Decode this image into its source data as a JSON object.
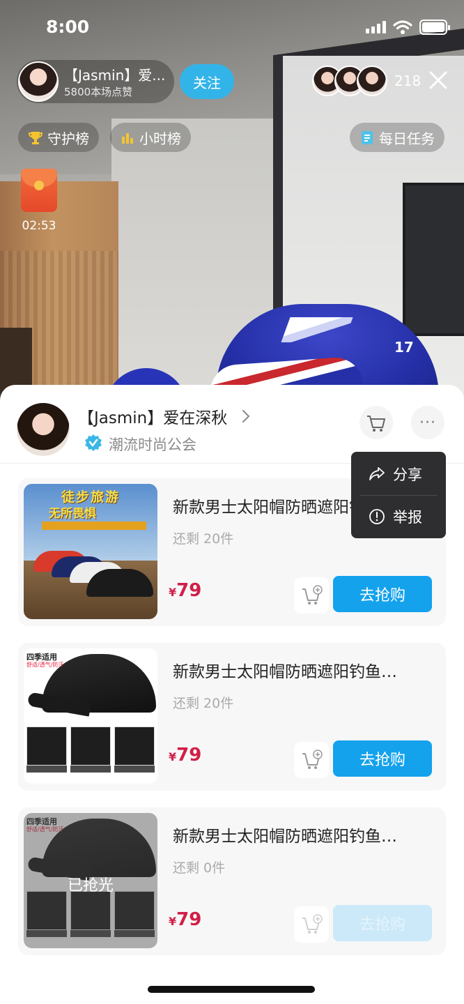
{
  "status_bar": {
    "time": "8:00"
  },
  "live_header": {
    "host_name": "【Jasmin】爱...",
    "likes": "5800本场点赞",
    "follow_label": "关注",
    "viewer_count": "218"
  },
  "ranking_pills": [
    {
      "label": "守护榜",
      "icon": "trophy-icon"
    },
    {
      "label": "小时榜",
      "icon": "bar-chart-icon"
    },
    {
      "label": "每日任务",
      "icon": "task-list-icon"
    }
  ],
  "red_packet": {
    "countdown": "02:53"
  },
  "sheet": {
    "host_name": "【Jasmin】爱在深秋",
    "guild_name": "潮流时尚公会"
  },
  "menu": {
    "share_label": "分享",
    "report_label": "举报"
  },
  "products": [
    {
      "title": "新款男士太阳帽防晒遮阳钓鱼…",
      "stock": "还剩 20件",
      "currency": "¥",
      "price": "79",
      "buy_label": "去抢购",
      "sold_out": false,
      "image_text": {
        "line1": "徒步旅游",
        "line2": "无所畏惧"
      }
    },
    {
      "title": "新款男士太阳帽防晒遮阳钓鱼…",
      "stock": "还剩 20件",
      "currency": "¥",
      "price": "79",
      "buy_label": "去抢购",
      "sold_out": false,
      "image_text": {
        "label": "四季适用",
        "sub": "舒适/透气/防汗"
      }
    },
    {
      "title": "新款男士太阳帽防晒遮阳钓鱼…",
      "stock": "还剩 0件",
      "currency": "¥",
      "price": "79",
      "buy_label": "去抢购",
      "sold_out": true,
      "sold_out_label": "已抢光",
      "image_text": {
        "label": "四季适用",
        "sub": "舒适/透气/防汗"
      }
    }
  ],
  "colors": {
    "accent_blue": "#14a2ec",
    "follow_blue": "#33b4e8",
    "price_red": "#d11f47",
    "menu_dark": "#2e2e30"
  }
}
